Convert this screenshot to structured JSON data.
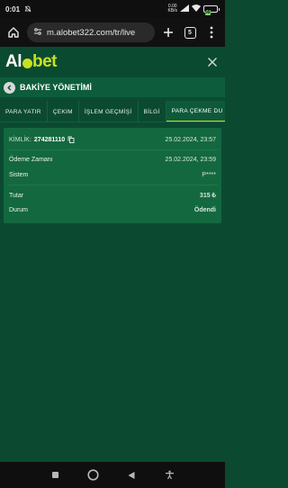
{
  "status_bar": {
    "time": "0:01",
    "speed_value": "0.00",
    "speed_unit": "KB/s",
    "battery_level": "99"
  },
  "browser": {
    "url": "m.alobet322.com/tr/live",
    "tab_count": "5"
  },
  "site": {
    "logo_prefix": "Al",
    "logo_suffix": "bet"
  },
  "page": {
    "title": "BAKİYE YÖNETİMİ"
  },
  "tabs": [
    {
      "label": "PARA YATIR",
      "active": false
    },
    {
      "label": "ÇEKIM",
      "active": false
    },
    {
      "label": "İŞLEM GEÇMİŞİ",
      "active": false
    },
    {
      "label": "BİLGİ",
      "active": false
    },
    {
      "label": "PARA ÇEKME DU",
      "active": true
    }
  ],
  "transaction": {
    "id_label": "KİMLİK:",
    "id_value": "274281110",
    "created_date": "25.02.2024, 23:57",
    "payment_time_label": "Ödeme Zamanı",
    "payment_time_value": "25.02.2024, 23:59",
    "system_label": "Sistem",
    "system_value": "P****",
    "amount_label": "Tutar",
    "amount_value": "315 ₺",
    "status_label": "Durum",
    "status_value": "Ödendi"
  },
  "colors": {
    "brand_accent": "#c8e21f",
    "page_bg": "#0b4a31",
    "card_bg": "#14683f",
    "amount": "#f6c400",
    "status_paid": "#1ed760"
  }
}
